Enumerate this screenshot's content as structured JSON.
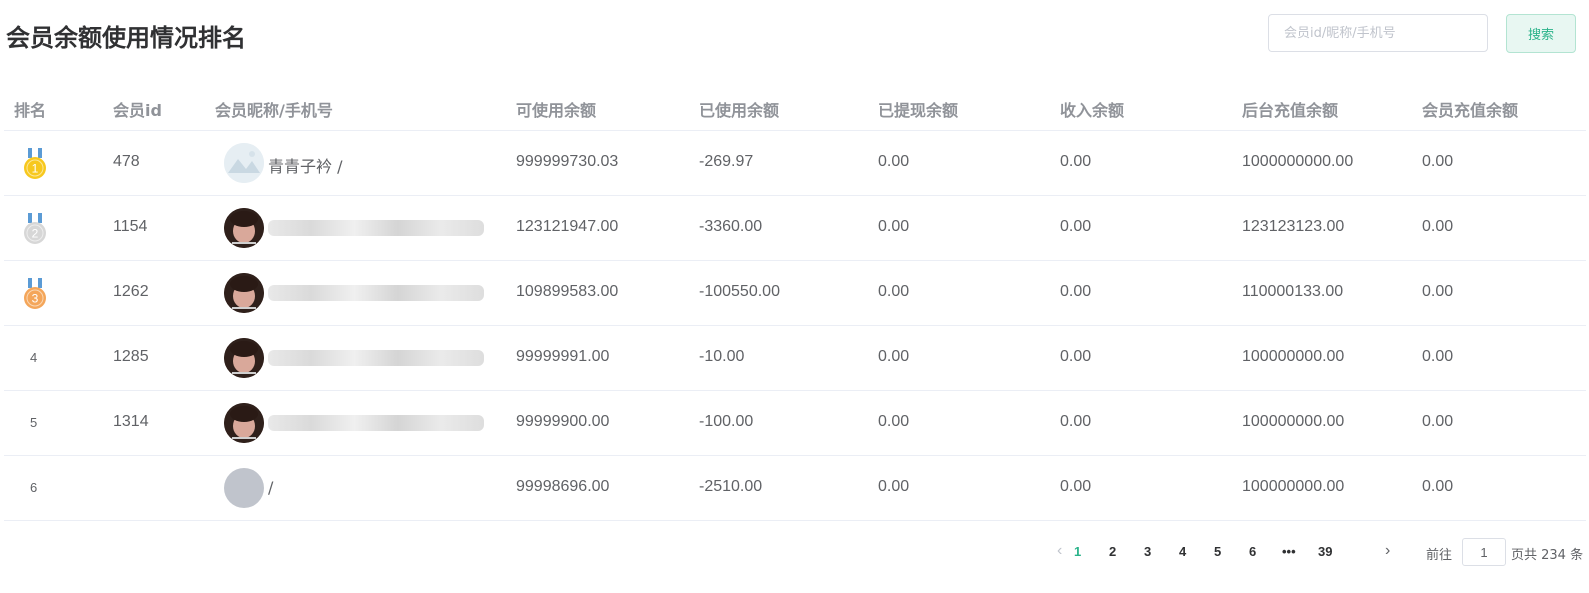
{
  "page": {
    "title": "会员余额使用情况排名"
  },
  "search": {
    "placeholder": "会员id/昵称/手机号",
    "button_label": "搜索"
  },
  "table": {
    "headers": [
      "排名",
      "会员id",
      "会员昵称/手机号",
      "可使用余额",
      "已使用余额",
      "已提现余额",
      "收入余额",
      "后台充值余额",
      "会员充值余额"
    ],
    "rows": [
      {
        "rank": "1",
        "id": "478",
        "nickname": "青青子衿 /",
        "available": "999999730.03",
        "used": "-269.97",
        "withdrawn": "0.00",
        "income": "0.00",
        "backend_recharge": "1000000000.00",
        "member_recharge": "0.00",
        "avatar": "landscape-placeholder",
        "medal": "gold"
      },
      {
        "rank": "2",
        "id": "1154",
        "nickname": "",
        "available": "123121947.00",
        "used": "-3360.00",
        "withdrawn": "0.00",
        "income": "0.00",
        "backend_recharge": "123123123.00",
        "member_recharge": "0.00",
        "avatar": "photo",
        "medal": "silver"
      },
      {
        "rank": "3",
        "id": "1262",
        "nickname": "",
        "available": "109899583.00",
        "used": "-100550.00",
        "withdrawn": "0.00",
        "income": "0.00",
        "backend_recharge": "110000133.00",
        "member_recharge": "0.00",
        "avatar": "photo",
        "medal": "bronze"
      },
      {
        "rank": "4",
        "id": "1285",
        "nickname": "",
        "available": "99999991.00",
        "used": "-10.00",
        "withdrawn": "0.00",
        "income": "0.00",
        "backend_recharge": "100000000.00",
        "member_recharge": "0.00",
        "avatar": "photo",
        "medal": ""
      },
      {
        "rank": "5",
        "id": "1314",
        "nickname": "",
        "available": "99999900.00",
        "used": "-100.00",
        "withdrawn": "0.00",
        "income": "0.00",
        "backend_recharge": "100000000.00",
        "member_recharge": "0.00",
        "avatar": "photo",
        "medal": ""
      },
      {
        "rank": "6",
        "id": "",
        "nickname": "/",
        "available": "99998696.00",
        "used": "-2510.00",
        "withdrawn": "0.00",
        "income": "0.00",
        "backend_recharge": "100000000.00",
        "member_recharge": "0.00",
        "avatar": "blank",
        "medal": ""
      }
    ]
  },
  "pagination": {
    "pages": [
      "1",
      "2",
      "3",
      "4",
      "5",
      "6",
      "•••",
      "39"
    ],
    "current": "1",
    "goto_prefix": "前往",
    "goto_value": "1",
    "goto_suffix": "页共 234 条"
  },
  "colors": {
    "accent": "#2bb38a",
    "gold": "#f7c81e",
    "silver": "#d7d7d7",
    "bronze": "#f4a65a",
    "ribbon": "#5b9bd5"
  }
}
